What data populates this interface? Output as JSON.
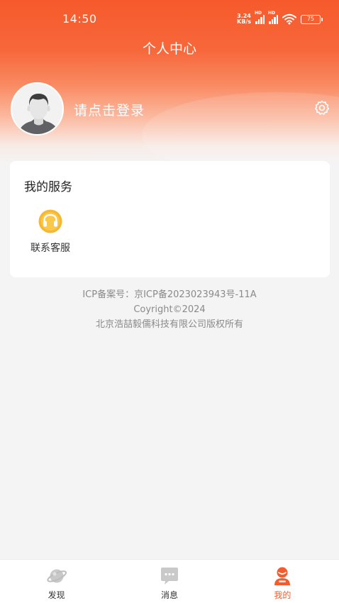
{
  "status_bar": {
    "time": "14:50",
    "net_speed_value": "3.24",
    "net_speed_unit": "KB/s",
    "signal_tag_1": "HD",
    "signal_tag_2": "HD",
    "battery": "75"
  },
  "header": {
    "title": "个人中心"
  },
  "profile": {
    "login_prompt": "请点击登录",
    "avatar_icon": "default-user-avatar",
    "settings_icon": "gear-icon"
  },
  "services": {
    "title": "我的服务",
    "items": [
      {
        "label": "联系客服",
        "icon": "headset-icon"
      }
    ]
  },
  "footer": {
    "icp": "ICP备案号：京ICP备2023023943号-11A",
    "copyright": "Coyright©2024",
    "company": "北京浩喆毅儒科技有限公司版权所有"
  },
  "tabs": [
    {
      "label": "发现",
      "icon": "planet-icon",
      "active": false
    },
    {
      "label": "消息",
      "icon": "chat-bubble-icon",
      "active": false
    },
    {
      "label": "我的",
      "icon": "user-profile-icon",
      "active": true
    }
  ],
  "colors": {
    "accent": "#f45c2c",
    "header_orange": "#f65a2c",
    "service_icon_yellow": "#f7b731"
  }
}
